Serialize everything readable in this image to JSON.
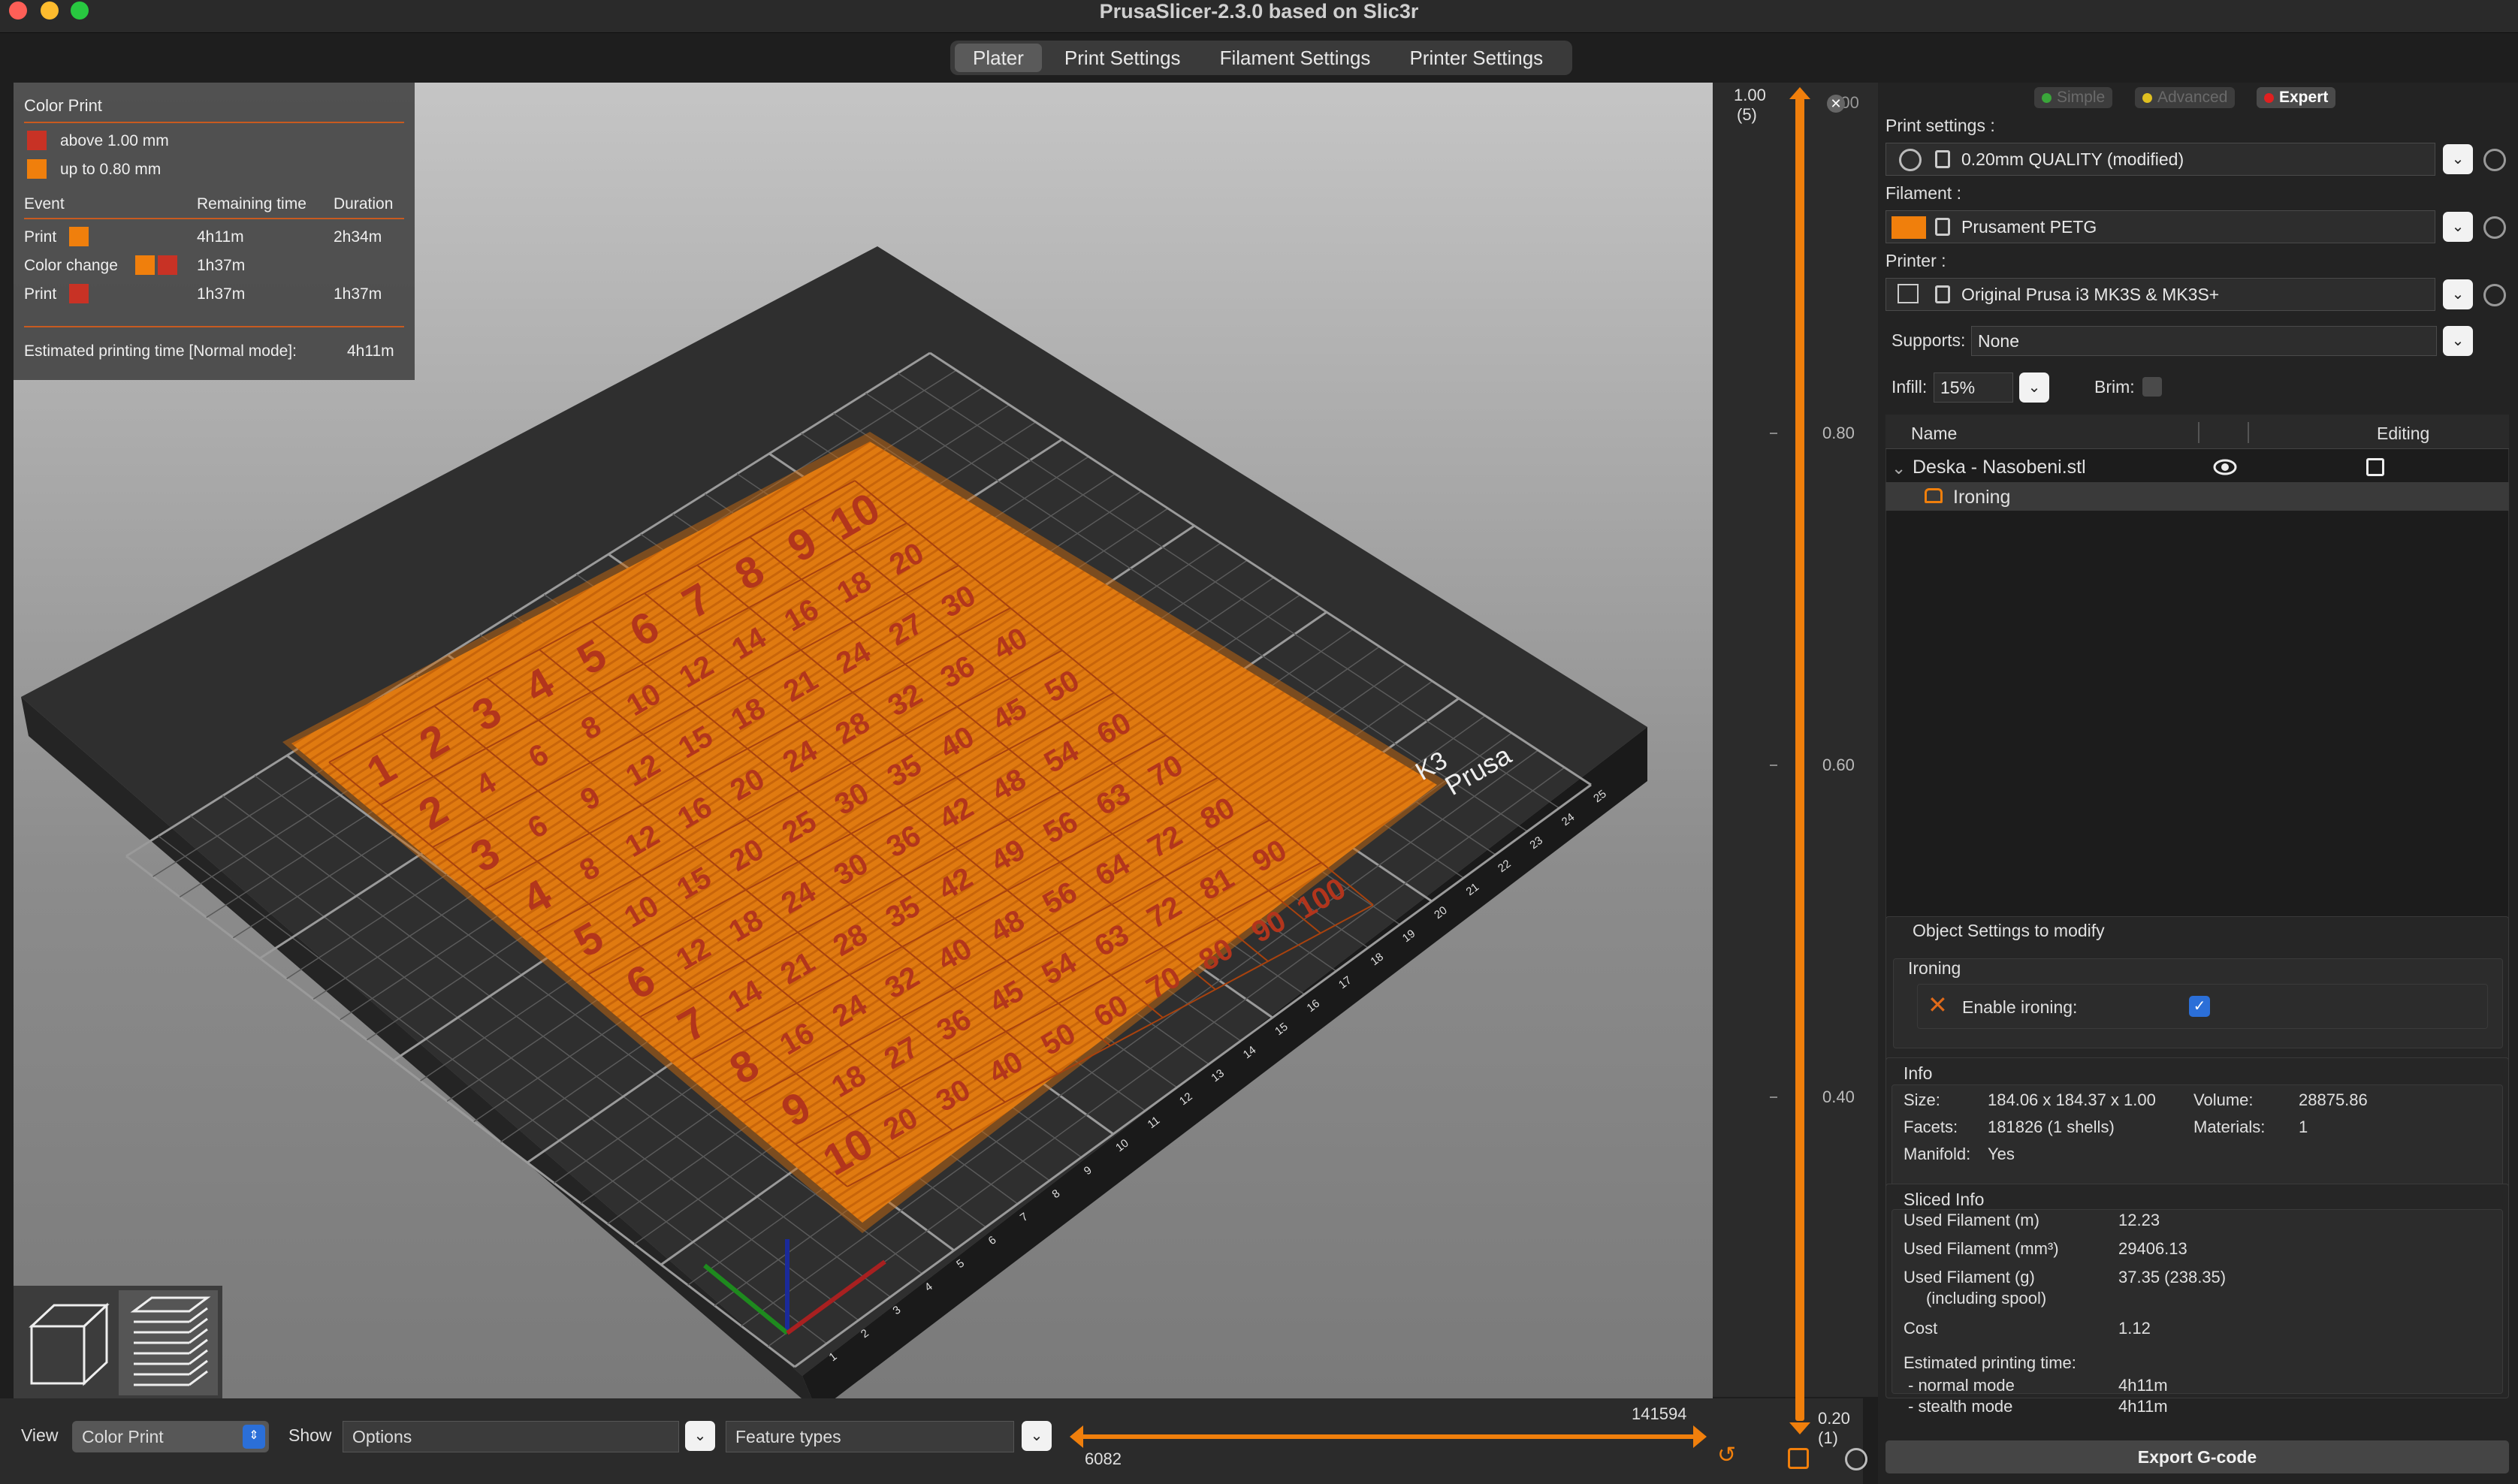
{
  "window": {
    "title": "PrusaSlicer-2.3.0 based on Slic3r"
  },
  "tabs": [
    "Plater",
    "Print Settings",
    "Filament Settings",
    "Printer Settings"
  ],
  "legend": {
    "title": "Color Print",
    "items": [
      {
        "label": "above 1.00 mm",
        "color": "#c83225"
      },
      {
        "label": "up to 0.80 mm",
        "color": "#f07f0c"
      }
    ],
    "headers": [
      "Event",
      "Remaining time",
      "Duration"
    ],
    "rows": [
      {
        "event": "Print",
        "remaining": "4h11m",
        "duration": "2h34m"
      },
      {
        "event": "Color change",
        "remaining": "1h37m",
        "duration": ""
      },
      {
        "event": "Print",
        "remaining": "1h37m",
        "duration": "1h37m"
      }
    ],
    "estimate": "Estimated printing time [Normal mode]:",
    "estimate_value": "4h11m"
  },
  "bed": {
    "label1": "K3",
    "label2": "Prusa",
    "ticks": [
      "1",
      "2",
      "3",
      "4",
      "5",
      "6",
      "7",
      "8",
      "9",
      "10",
      "11",
      "12",
      "13",
      "14",
      "15",
      "16",
      "17",
      "18",
      "19",
      "20",
      "21",
      "22",
      "23",
      "24",
      "25"
    ],
    "table": [
      "1",
      "2",
      "3",
      "4",
      "5",
      "6",
      "7",
      "8",
      "9",
      "10",
      "2",
      "4",
      "6",
      "8",
      "10",
      "12",
      "14",
      "16",
      "18",
      "20",
      "3",
      "6",
      "9",
      "12",
      "15",
      "18",
      "21",
      "24",
      "27",
      "30",
      "4",
      "8",
      "12",
      "16",
      "20",
      "24",
      "28",
      "32",
      "36",
      "40",
      "5",
      "10",
      "15",
      "20",
      "25",
      "30",
      "35",
      "40",
      "45",
      "50",
      "6",
      "12",
      "18",
      "24",
      "30",
      "36",
      "42",
      "48",
      "54",
      "60",
      "7",
      "14",
      "21",
      "28",
      "35",
      "42",
      "49",
      "56",
      "63",
      "70",
      "8",
      "16",
      "24",
      "32",
      "40",
      "48",
      "56",
      "64",
      "72",
      "80",
      "9",
      "18",
      "27",
      "36",
      "45",
      "54",
      "63",
      "72",
      "81",
      "90",
      "10",
      "20",
      "30",
      "40",
      "50",
      "60",
      "70",
      "80",
      "90",
      "100"
    ]
  },
  "bottom": {
    "view_label": "View",
    "view_value": "Color Print",
    "show_label": "Show",
    "options_value": "Options",
    "features_value": "Feature types",
    "h_max": "141594",
    "h_min": "6082"
  },
  "vslider": {
    "top_value": "1.00",
    "top_layer": "(5)",
    "top_thumb": "1.00",
    "ticks": [
      "0.80",
      "0.60",
      "0.40"
    ],
    "bottom_value": "0.20",
    "bottom_layer": "(1)"
  },
  "modes": [
    "Simple",
    "Advanced",
    "Expert"
  ],
  "settings": {
    "print_label": "Print settings :",
    "print_value": "0.20mm QUALITY (modified)",
    "filament_label": "Filament :",
    "filament_value": "Prusament PETG",
    "filament_color": "#f07f0c",
    "printer_label": "Printer :",
    "printer_value": "Original Prusa i3 MK3S & MK3S+",
    "supports_label": "Supports:",
    "supports_value": "None",
    "infill_label": "Infill:",
    "infill_value": "15%",
    "brim_label": "Brim:"
  },
  "objects": {
    "col_name": "Name",
    "col_editing": "Editing",
    "object": "Deska - Nasobeni.stl",
    "modifier": "Ironing"
  },
  "object_settings": {
    "title": "Object Settings to modify",
    "group": "Ironing",
    "option": "Enable ironing:",
    "checked": true
  },
  "info": {
    "title": "Info",
    "size_label": "Size:",
    "size_value": "184.06 x 184.37 x 1.00",
    "volume_label": "Volume:",
    "volume_value": "28875.86",
    "facets_label": "Facets:",
    "facets_value": "181826 (1 shells)",
    "materials_label": "Materials:",
    "materials_value": "1",
    "manifold_label": "Manifold:",
    "manifold_value": "Yes"
  },
  "sliced": {
    "title": "Sliced Info",
    "rows": [
      {
        "label": "Used Filament (m)",
        "value": "12.23"
      },
      {
        "label": "Used Filament (mm³)",
        "value": "29406.13"
      },
      {
        "label": "Used Filament (g)",
        "value": "37.35 (238.35)"
      },
      {
        "label": "(including spool)",
        "value": ""
      },
      {
        "label": "Cost",
        "value": "1.12"
      },
      {
        "label": "Estimated printing time:",
        "value": ""
      },
      {
        "label": "- normal mode",
        "value": "4h11m"
      },
      {
        "label": "- stealth mode",
        "value": "4h11m"
      }
    ]
  },
  "export_label": "Export G-code"
}
